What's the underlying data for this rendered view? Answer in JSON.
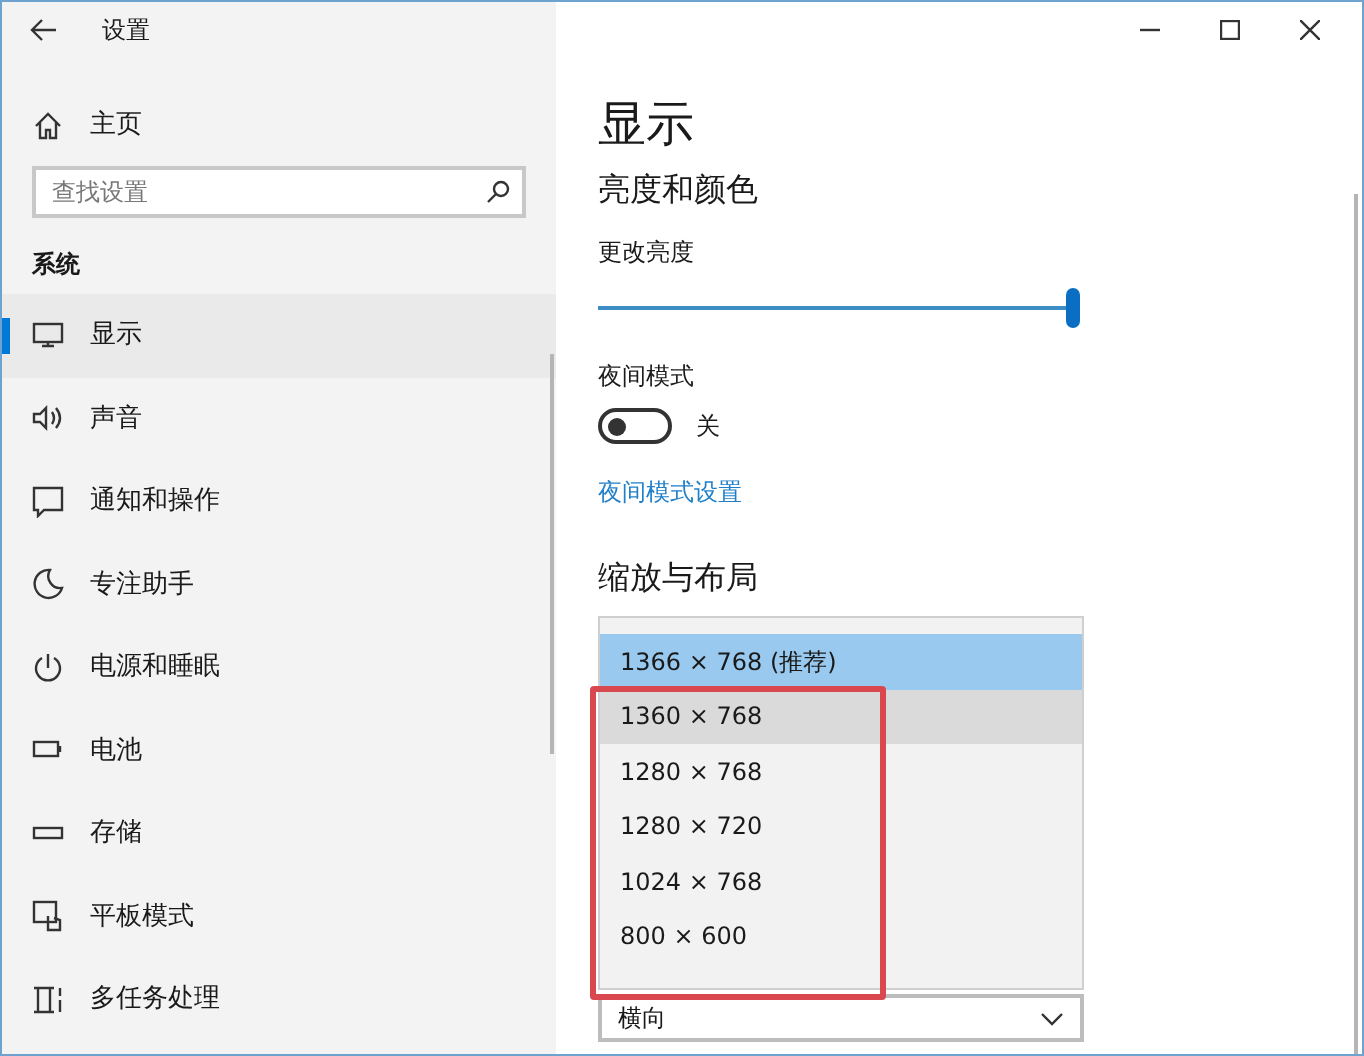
{
  "window": {
    "title": "设置"
  },
  "sidebar": {
    "home": "主页",
    "search": {
      "placeholder": "查找设置"
    },
    "section": "系统",
    "items": [
      {
        "label": "显示",
        "selected": true
      },
      {
        "label": "声音",
        "selected": false
      },
      {
        "label": "通知和操作",
        "selected": false
      },
      {
        "label": "专注助手",
        "selected": false
      },
      {
        "label": "电源和睡眠",
        "selected": false
      },
      {
        "label": "电池",
        "selected": false
      },
      {
        "label": "存储",
        "selected": false
      },
      {
        "label": "平板模式",
        "selected": false
      },
      {
        "label": "多任务处理",
        "selected": false
      }
    ]
  },
  "page": {
    "title": "显示",
    "brightness_section": "亮度和颜色",
    "brightness": {
      "label": "更改亮度",
      "level": 1.0
    },
    "night_mode": {
      "label": "夜间模式",
      "on": false,
      "state_text": "关"
    },
    "night_link": "夜间模式设置",
    "layout_section": "缩放与布局",
    "resolution_options": [
      {
        "label": "1366 × 768 (推荐)",
        "selected": true,
        "hover": false
      },
      {
        "label": "1360 × 768",
        "selected": false,
        "hover": true
      },
      {
        "label": "1280 × 768",
        "selected": false,
        "hover": false
      },
      {
        "label": "1280 × 720",
        "selected": false,
        "hover": false
      },
      {
        "label": "1024 × 768",
        "selected": false,
        "hover": false
      },
      {
        "label": "800 × 600",
        "selected": false,
        "hover": false
      }
    ],
    "annotation": {
      "kind": "frame"
    },
    "orientation": {
      "value": "横向"
    }
  }
}
